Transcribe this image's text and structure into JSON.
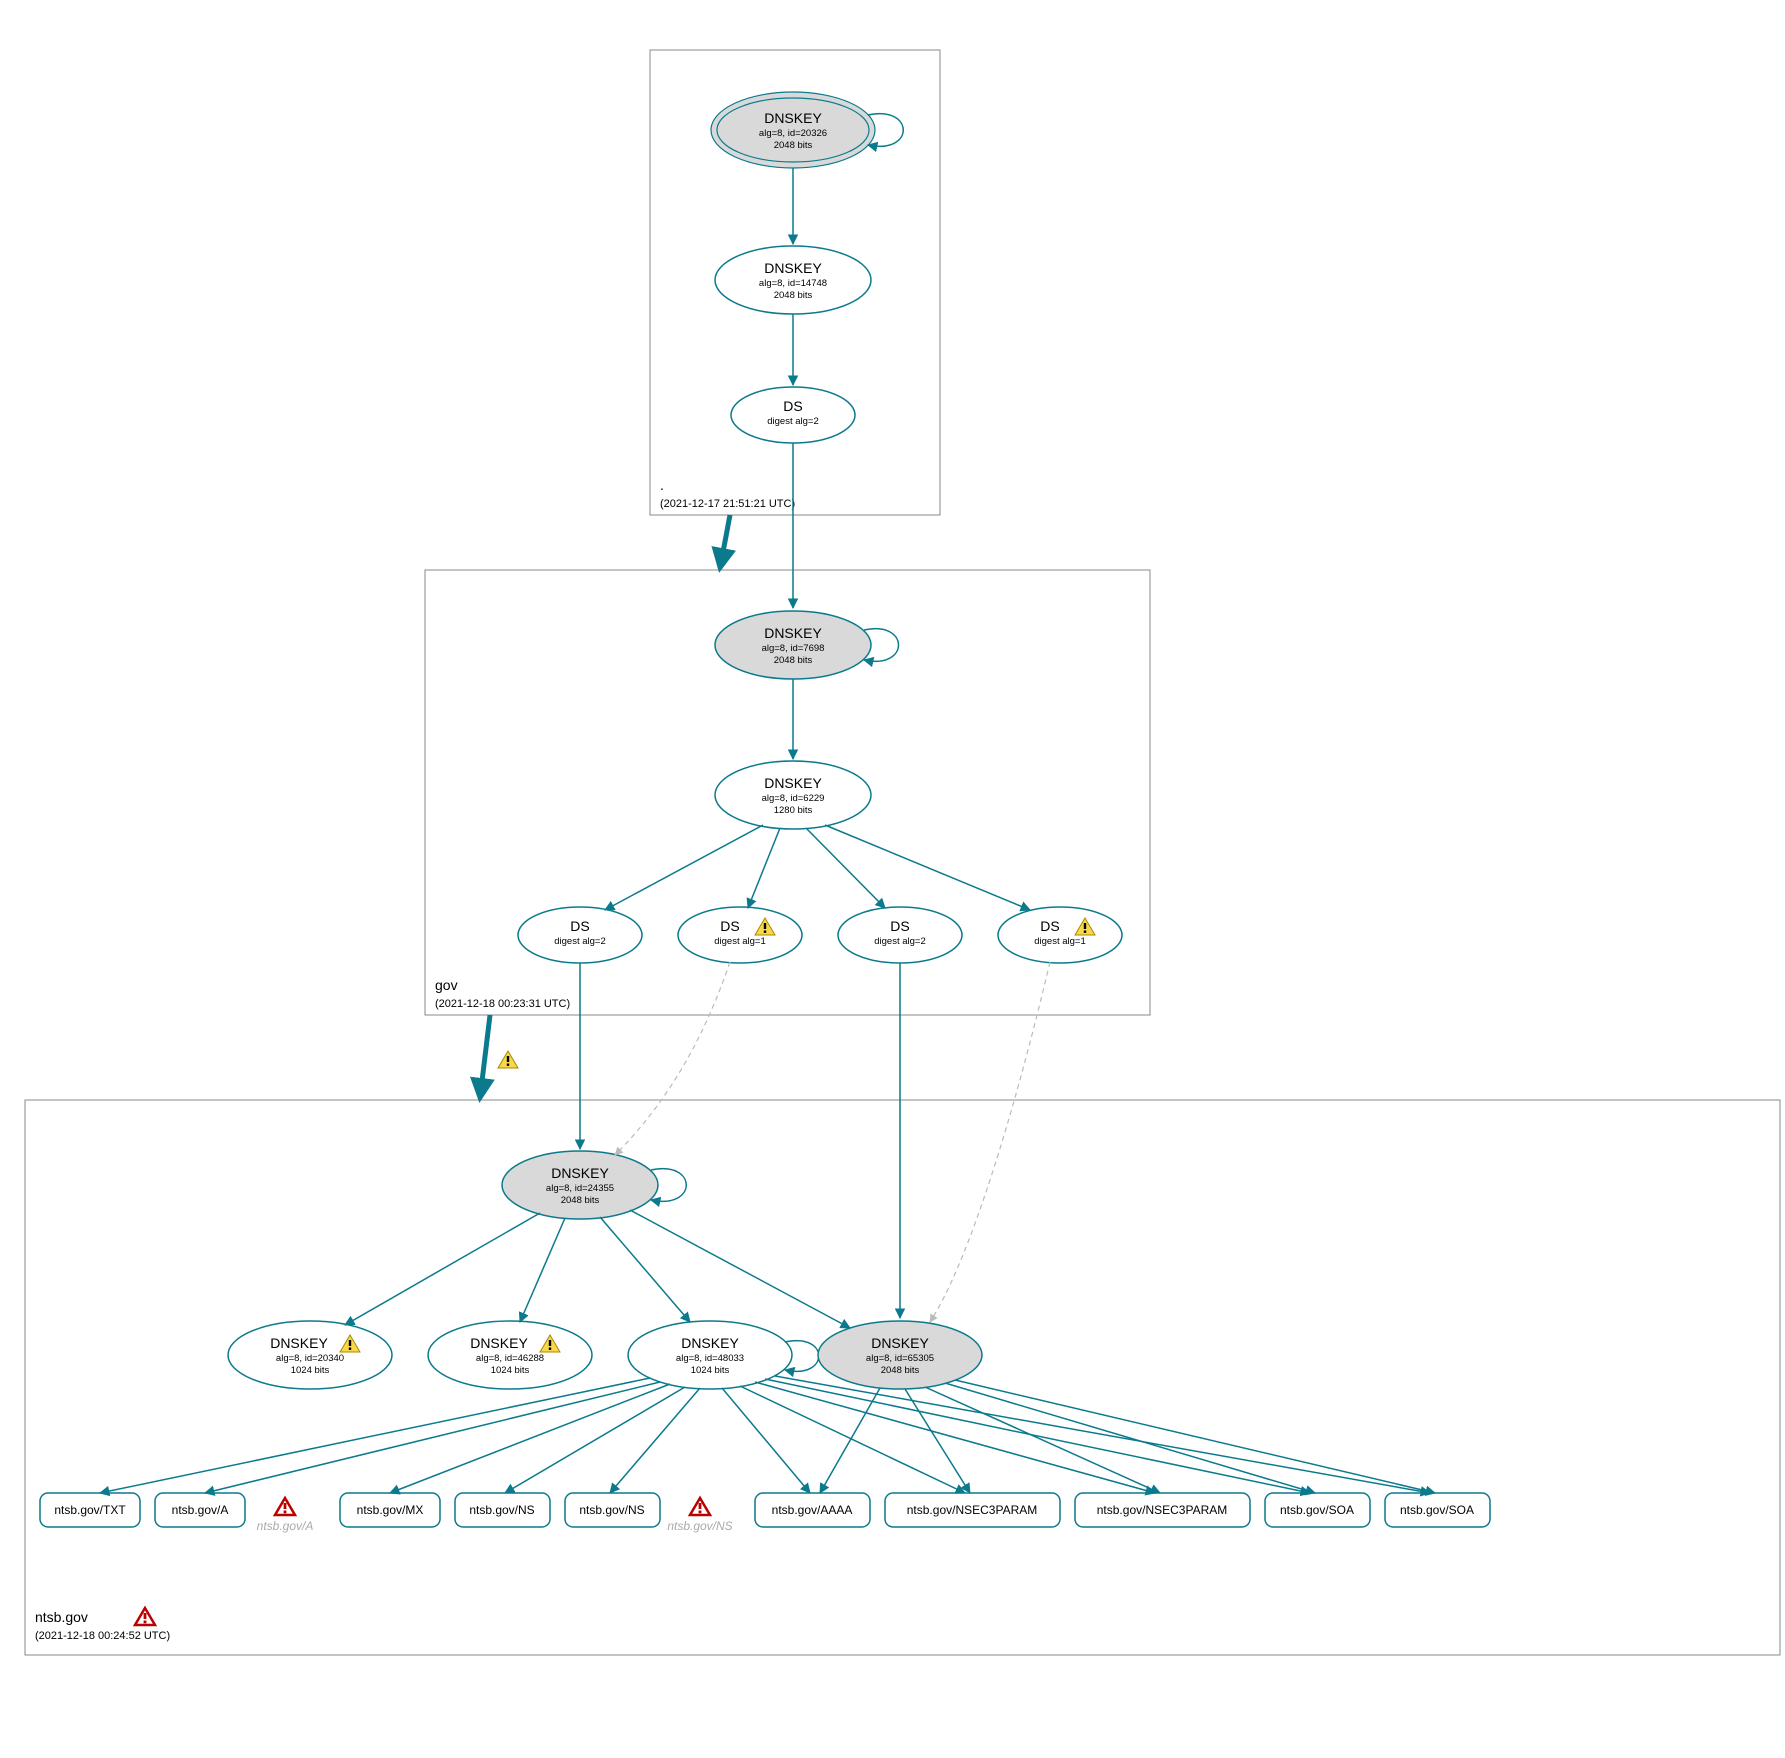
{
  "zones": {
    "root": {
      "name": ".",
      "timestamp": "(2021-12-17 21:51:21 UTC)"
    },
    "gov": {
      "name": "gov",
      "timestamp": "(2021-12-18 00:23:31 UTC)"
    },
    "ntsb": {
      "name": "ntsb.gov",
      "timestamp": "(2021-12-18 00:24:52 UTC)"
    }
  },
  "nodes": {
    "root_ksk": {
      "title": "DNSKEY",
      "line2": "alg=8, id=20326",
      "line3": "2048 bits"
    },
    "root_zsk": {
      "title": "DNSKEY",
      "line2": "alg=8, id=14748",
      "line3": "2048 bits"
    },
    "root_ds": {
      "title": "DS",
      "line2": "digest alg=2",
      "line3": ""
    },
    "gov_ksk": {
      "title": "DNSKEY",
      "line2": "alg=8, id=7698",
      "line3": "2048 bits"
    },
    "gov_zsk": {
      "title": "DNSKEY",
      "line2": "alg=8, id=6229",
      "line3": "1280 bits"
    },
    "gov_ds1": {
      "title": "DS",
      "line2": "digest alg=2",
      "line3": ""
    },
    "gov_ds2": {
      "title": "DS",
      "line2": "digest alg=1",
      "line3": ""
    },
    "gov_ds3": {
      "title": "DS",
      "line2": "digest alg=2",
      "line3": ""
    },
    "gov_ds4": {
      "title": "DS",
      "line2": "digest alg=1",
      "line3": ""
    },
    "ntsb_ksk": {
      "title": "DNSKEY",
      "line2": "alg=8, id=24355",
      "line3": "2048 bits"
    },
    "ntsb_k1": {
      "title": "DNSKEY",
      "line2": "alg=8, id=20340",
      "line3": "1024 bits"
    },
    "ntsb_k2": {
      "title": "DNSKEY",
      "line2": "alg=8, id=46288",
      "line3": "1024 bits"
    },
    "ntsb_k3": {
      "title": "DNSKEY",
      "line2": "alg=8, id=48033",
      "line3": "1024 bits"
    },
    "ntsb_k4": {
      "title": "DNSKEY",
      "line2": "alg=8, id=65305",
      "line3": "2048 bits"
    }
  },
  "rr": {
    "txt": "ntsb.gov/TXT",
    "a": "ntsb.gov/A",
    "a_grey": "ntsb.gov/A",
    "mx": "ntsb.gov/MX",
    "ns1": "ntsb.gov/NS",
    "ns2": "ntsb.gov/NS",
    "ns_grey": "ntsb.gov/NS",
    "aaaa": "ntsb.gov/AAAA",
    "n3p1": "ntsb.gov/NSEC3PARAM",
    "n3p2": "ntsb.gov/NSEC3PARAM",
    "soa1": "ntsb.gov/SOA",
    "soa2": "ntsb.gov/SOA"
  }
}
